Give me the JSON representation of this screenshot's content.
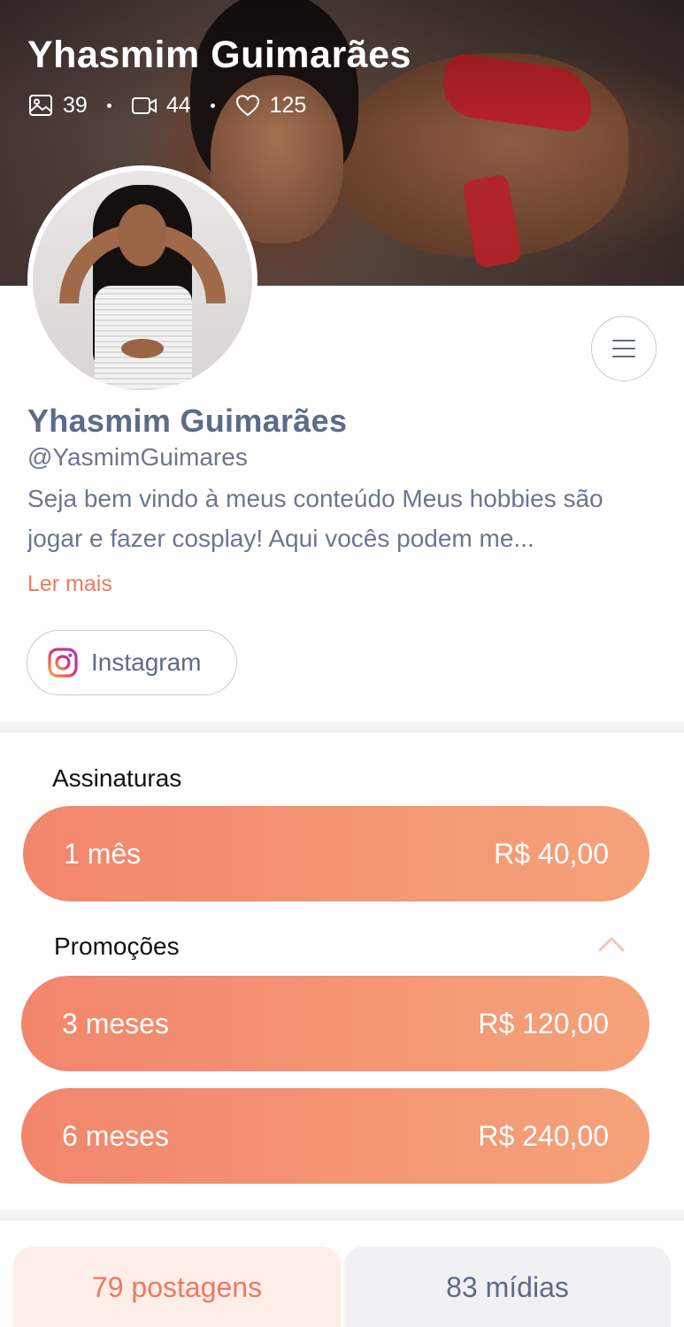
{
  "cover": {
    "title": "Yhasmim Guimarães",
    "stats": {
      "photos": "39",
      "videos": "44",
      "likes": "125"
    }
  },
  "profile": {
    "name": "Yhasmim Guimarães",
    "handle": "@YasmimGuimares",
    "bio": "Seja bem vindo à meus conteúdo Meus hobbies são jogar e fazer cosplay! Aqui vocês podem me...",
    "read_more": "Ler mais",
    "instagram_label": "Instagram"
  },
  "subscriptions": {
    "title": "Assinaturas",
    "plans": [
      {
        "label": "1 mês",
        "price": "R$ 40,00"
      }
    ]
  },
  "promotions": {
    "title": "Promoções",
    "plans": [
      {
        "label": "3 meses",
        "price": "R$ 120,00"
      },
      {
        "label": "6 meses",
        "price": "R$ 240,00"
      }
    ]
  },
  "tabs": {
    "posts": "79 postagens",
    "media": "83 mídias"
  },
  "colors": {
    "accent": "#f0795e",
    "plan_gradient_start": "#f2866c",
    "plan_gradient_end": "#f5a27a",
    "name_text": "#5d6b8a"
  },
  "icons": [
    "image-icon",
    "video-icon",
    "heart-icon",
    "menu-icon",
    "instagram-icon",
    "chevron-up-icon"
  ]
}
